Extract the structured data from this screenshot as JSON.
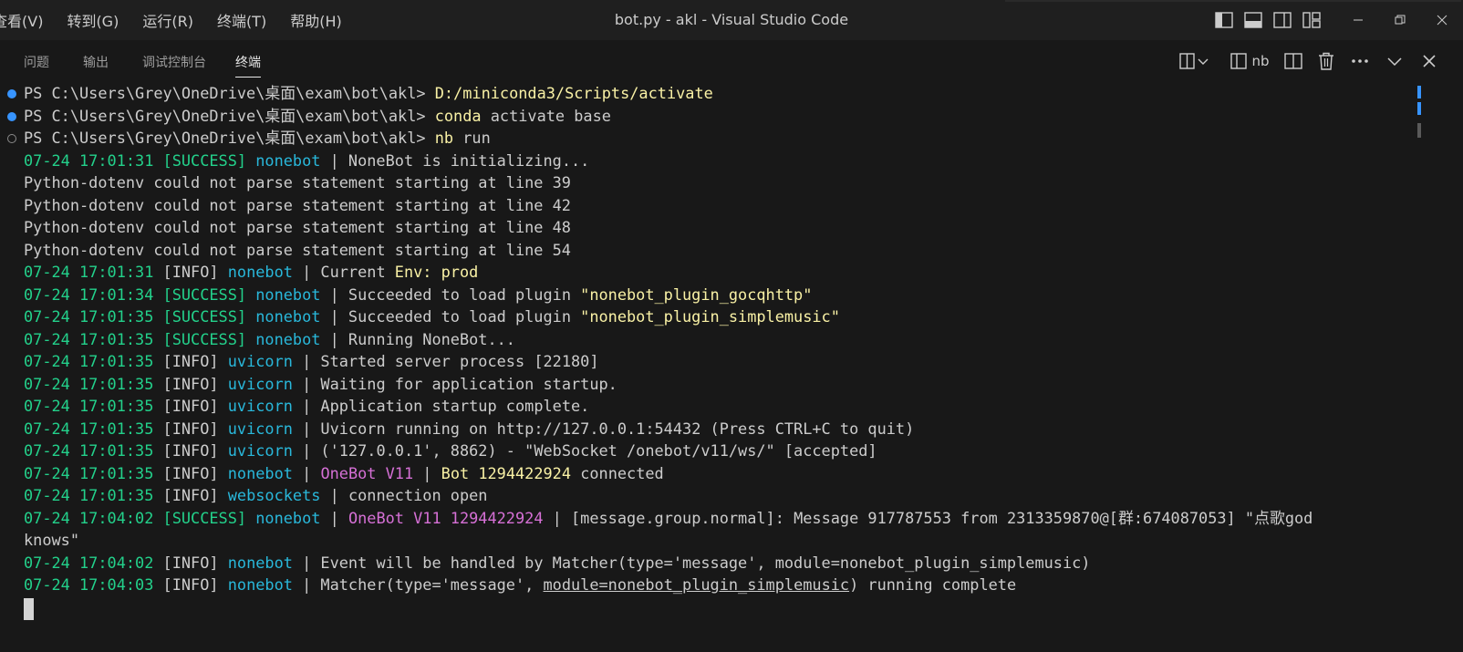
{
  "titlebar": {
    "menu": [
      "查看(V)",
      "转到(G)",
      "运行(R)",
      "终端(T)",
      "帮助(H)"
    ],
    "window_title": "bot.py - akl - Visual Studio Code",
    "layout_icons": [
      "toggle-primary-sidebar-icon",
      "toggle-panel-icon",
      "toggle-secondary-sidebar-icon",
      "customize-layout-icon"
    ],
    "window_controls": [
      "minimize-icon",
      "restore-icon",
      "close-icon"
    ]
  },
  "panel": {
    "tabs": [
      {
        "label": "问题",
        "active": false
      },
      {
        "label": "输出",
        "active": false
      },
      {
        "label": "调试控制台",
        "active": false
      },
      {
        "label": "终端",
        "active": true
      }
    ],
    "actions": {
      "terminal_name": "nb",
      "icons": [
        "split-terminal-icon",
        "chevron-down-icon",
        "terminal-icon",
        "split-editor-icon",
        "trash-icon",
        "more-icon",
        "chevron-down-icon",
        "close-icon"
      ]
    }
  },
  "colors": {
    "title_bg": "#1f1f1f",
    "panel_bg": "#181818",
    "text": "#cccccc",
    "yellow": "#f9f1a5",
    "green": "#23d18b",
    "cyan": "#29b8db",
    "magenta": "#d670d6",
    "command_dot": "#3794ff"
  },
  "terminal": {
    "lines": [
      {
        "dot": "filled",
        "segs": [
          [
            "w",
            "PS C:\\Users\\Grey\\OneDrive\\桌面\\exam\\bot\\akl> "
          ],
          [
            "y",
            "D:/miniconda3/Scripts/activate"
          ]
        ]
      },
      {
        "dot": "filled",
        "segs": [
          [
            "w",
            "PS C:\\Users\\Grey\\OneDrive\\桌面\\exam\\bot\\akl> "
          ],
          [
            "y",
            "conda"
          ],
          [
            "w",
            " activate base"
          ]
        ]
      },
      {
        "dot": "hollow",
        "segs": [
          [
            "w",
            "PS C:\\Users\\Grey\\OneDrive\\桌面\\exam\\bot\\akl> "
          ],
          [
            "y",
            "nb"
          ],
          [
            "w",
            " run"
          ]
        ]
      },
      {
        "segs": [
          [
            "g",
            "07-24 17:01:31 [SUCCESS] "
          ],
          [
            "b",
            "nonebot"
          ],
          [
            "w",
            " | NoneBot is initializing..."
          ]
        ]
      },
      {
        "segs": [
          [
            "w",
            "Python-dotenv could not parse statement starting at line 39"
          ]
        ]
      },
      {
        "segs": [
          [
            "w",
            "Python-dotenv could not parse statement starting at line 42"
          ]
        ]
      },
      {
        "segs": [
          [
            "w",
            "Python-dotenv could not parse statement starting at line 48"
          ]
        ]
      },
      {
        "segs": [
          [
            "w",
            "Python-dotenv could not parse statement starting at line 54"
          ]
        ]
      },
      {
        "segs": [
          [
            "g",
            "07-24 17:01:31 "
          ],
          [
            "w",
            "[INFO] "
          ],
          [
            "b",
            "nonebot"
          ],
          [
            "w",
            " | Current "
          ],
          [
            "y",
            "Env: prod"
          ]
        ]
      },
      {
        "segs": [
          [
            "g",
            "07-24 17:01:34 [SUCCESS] "
          ],
          [
            "b",
            "nonebot"
          ],
          [
            "w",
            " | Succeeded to load plugin "
          ],
          [
            "y",
            "\"nonebot_plugin_gocqhttp\""
          ]
        ]
      },
      {
        "segs": [
          [
            "g",
            "07-24 17:01:35 [SUCCESS] "
          ],
          [
            "b",
            "nonebot"
          ],
          [
            "w",
            " | Succeeded to load plugin "
          ],
          [
            "y",
            "\"nonebot_plugin_simplemusic\""
          ]
        ]
      },
      {
        "segs": [
          [
            "g",
            "07-24 17:01:35 [SUCCESS] "
          ],
          [
            "b",
            "nonebot"
          ],
          [
            "w",
            " | Running NoneBot..."
          ]
        ]
      },
      {
        "segs": [
          [
            "g",
            "07-24 17:01:35 "
          ],
          [
            "w",
            "[INFO] "
          ],
          [
            "b",
            "uvicorn"
          ],
          [
            "w",
            " | Started server process [22180]"
          ]
        ]
      },
      {
        "segs": [
          [
            "g",
            "07-24 17:01:35 "
          ],
          [
            "w",
            "[INFO] "
          ],
          [
            "b",
            "uvicorn"
          ],
          [
            "w",
            " | Waiting for application startup."
          ]
        ]
      },
      {
        "segs": [
          [
            "g",
            "07-24 17:01:35 "
          ],
          [
            "w",
            "[INFO] "
          ],
          [
            "b",
            "uvicorn"
          ],
          [
            "w",
            " | Application startup complete."
          ]
        ]
      },
      {
        "segs": [
          [
            "g",
            "07-24 17:01:35 "
          ],
          [
            "w",
            "[INFO] "
          ],
          [
            "b",
            "uvicorn"
          ],
          [
            "w",
            " | Uvicorn running on http://127.0.0.1:54432 (Press CTRL+C to quit)"
          ]
        ]
      },
      {
        "segs": [
          [
            "g",
            "07-24 17:01:35 "
          ],
          [
            "w",
            "[INFO] "
          ],
          [
            "b",
            "uvicorn"
          ],
          [
            "w",
            " | ('127.0.0.1', 8862) - \"WebSocket /onebot/v11/ws/\" [accepted]"
          ]
        ]
      },
      {
        "segs": [
          [
            "g",
            "07-24 17:01:35 "
          ],
          [
            "w",
            "[INFO] "
          ],
          [
            "b",
            "nonebot"
          ],
          [
            "w",
            " | "
          ],
          [
            "m",
            "OneBot V11"
          ],
          [
            "w",
            " | "
          ],
          [
            "y",
            "Bot 1294422924"
          ],
          [
            "w",
            " connected"
          ]
        ]
      },
      {
        "segs": [
          [
            "g",
            "07-24 17:01:35 "
          ],
          [
            "w",
            "[INFO] "
          ],
          [
            "b",
            "websockets"
          ],
          [
            "w",
            " | connection open"
          ]
        ]
      },
      {
        "segs": [
          [
            "g",
            "07-24 17:04:02 [SUCCESS] "
          ],
          [
            "b",
            "nonebot"
          ],
          [
            "w",
            " | "
          ],
          [
            "m",
            "OneBot V11 1294422924"
          ],
          [
            "w",
            " | [message.group.normal]: Message 917787553 from 2313359870@[群:674087053] \"点歌god"
          ]
        ]
      },
      {
        "segs": [
          [
            "w",
            "knows\""
          ]
        ]
      },
      {
        "segs": [
          [
            "g",
            "07-24 17:04:02 "
          ],
          [
            "w",
            "[INFO] "
          ],
          [
            "b",
            "nonebot"
          ],
          [
            "w",
            " | Event will be handled by Matcher(type='message', module=nonebot_plugin_simplemusic)"
          ]
        ]
      },
      {
        "segs": [
          [
            "g",
            "07-24 17:04:03 "
          ],
          [
            "w",
            "[INFO] "
          ],
          [
            "b",
            "nonebot"
          ],
          [
            "w",
            " | Matcher(type='message', "
          ],
          [
            "wu",
            "module=nonebot_plugin_simplemusic"
          ],
          [
            "w",
            ") running complete"
          ]
        ]
      }
    ]
  }
}
